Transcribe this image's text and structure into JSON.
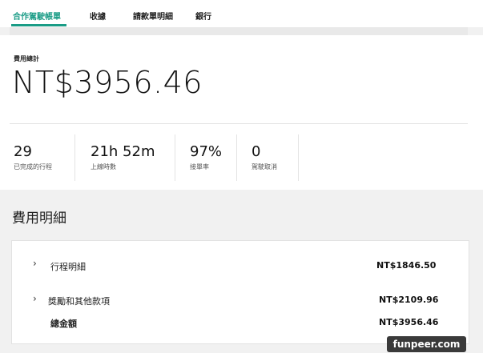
{
  "tabs": [
    {
      "label": "合作駕駛帳單",
      "active": true
    },
    {
      "label": "收據",
      "active": false
    },
    {
      "label": "請款單明細",
      "active": false
    },
    {
      "label": "銀行",
      "active": false
    }
  ],
  "summary": {
    "label": "費用總計",
    "total": "NT$3956.46"
  },
  "stats": [
    {
      "value": "29",
      "label": "已完成的行程"
    },
    {
      "value": "21h 52m",
      "label": "上線時數"
    },
    {
      "value": "97%",
      "label": "接單率"
    },
    {
      "value": "0",
      "label": "駕駛取消"
    }
  ],
  "breakdown": {
    "title": "費用明細",
    "rows": [
      {
        "label": "行程明細",
        "value": "NT$1846.50"
      },
      {
        "label": "獎勵和其他款項",
        "value": "NT$2109.96"
      }
    ],
    "total_label": "總金額",
    "total_value": "NT$3956.46"
  },
  "watermark": "funpeer.com",
  "colors": {
    "accent": "#1a9c86"
  }
}
